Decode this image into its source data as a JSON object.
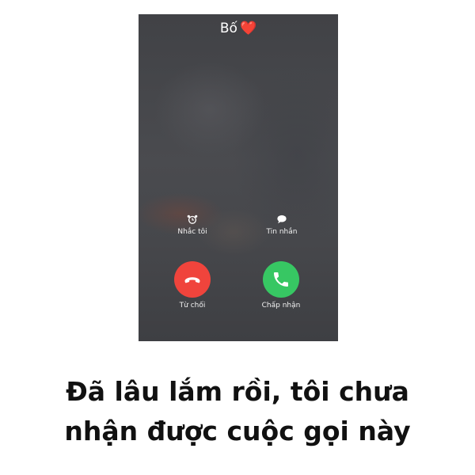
{
  "caller": {
    "name": "Bố",
    "emoji": "❤️"
  },
  "quick_actions": {
    "remind_label": "Nhắc tôi",
    "remind_icon": "alarm-clock-icon",
    "message_label": "Tin nhắn",
    "message_icon": "speech-bubble-icon"
  },
  "call_actions": {
    "decline_label": "Từ chối",
    "decline_color": "#f0443c",
    "decline_icon": "hang-up-icon",
    "accept_label": "Chấp nhận",
    "accept_color": "#37c763",
    "accept_icon": "phone-icon"
  },
  "caption": {
    "line1": "Đã lâu lắm rồi, tôi chưa",
    "line2": "nhận được cuộc gọi này"
  }
}
